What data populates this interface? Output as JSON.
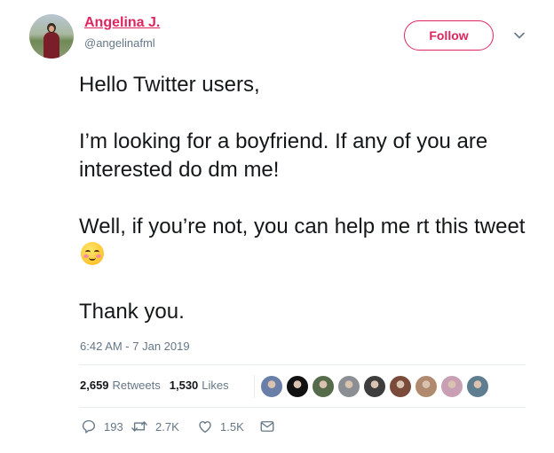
{
  "author": {
    "name": "Angelina J.",
    "handle": "@angelinafml"
  },
  "follow_label": "Follow",
  "tweet": {
    "line1": "Hello Twitter users,",
    "line2": "I’m looking for a boyfriend. If any of you are interested do dm me!",
    "line3": "Well, if you’re not, you can help me rt this tweet",
    "line3_emoji": "smiling-face-with-blush-emoji",
    "line4": "Thank you."
  },
  "timestamp": "6:42 AM - 7 Jan 2019",
  "stats": {
    "retweets_count": "2,659",
    "retweets_label": "Retweets",
    "likes_count": "1,530",
    "likes_label": "Likes"
  },
  "liker_avatars": [
    {
      "color": "#6a7fa8"
    },
    {
      "color": "#111111"
    },
    {
      "color": "#556b4a"
    },
    {
      "color": "#8b8f93"
    },
    {
      "color": "#3d3d3d"
    },
    {
      "color": "#7a4b3a"
    },
    {
      "color": "#b08a6e"
    },
    {
      "color": "#c9a0b3"
    },
    {
      "color": "#5e7d8f"
    }
  ],
  "actions": {
    "reply_count": "193",
    "retweet_count": "2.7K",
    "like_count": "1.5K"
  },
  "colors": {
    "accent": "#e0245e",
    "secondary_text": "#657786",
    "primary_text": "#14171a",
    "divider": "#e6ecf0"
  },
  "icons": [
    "chevron-down-icon",
    "reply-icon",
    "retweet-icon",
    "heart-icon",
    "envelope-icon"
  ]
}
